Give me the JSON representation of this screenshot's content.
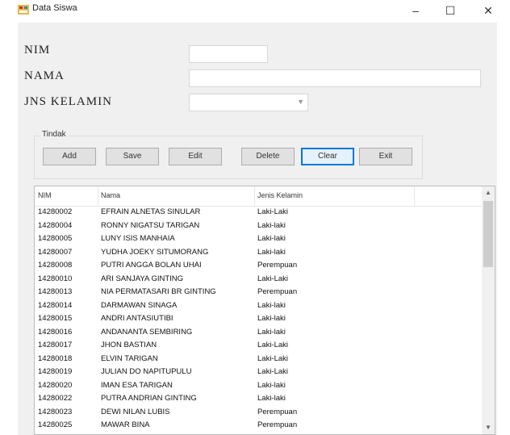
{
  "window": {
    "title": "Data Siswa",
    "min_glyph": "–",
    "max_glyph": "☐",
    "close_glyph": "✕"
  },
  "form": {
    "nim_label": "NIM",
    "nama_label": "NAMA",
    "jk_label": "JNS KELAMIN",
    "nim_value": "",
    "nama_value": "",
    "jk_value": ""
  },
  "group": {
    "legend": "Tindak",
    "buttons": [
      "Add",
      "Save",
      "Edit",
      "Delete",
      "Clear",
      "Exit"
    ]
  },
  "table": {
    "columns": [
      "NIM",
      "Nama",
      "Jenis Kelamin"
    ],
    "rows": [
      [
        "14280002",
        "EFRAIN ALNETAS SINULAR",
        "Laki-Laki"
      ],
      [
        "14280004",
        "RONNY NIGATSU TARIGAN",
        "Laki-laki"
      ],
      [
        "14280005",
        "LUNY ISIS MANHAIA",
        "Laki-laki"
      ],
      [
        "14280007",
        "YUDHA JOEKY SITUMORANG",
        "Laki-laki"
      ],
      [
        "14280008",
        "PUTRI ANGGA BOLAN UHAI",
        "Perempuan"
      ],
      [
        "14280010",
        "ARI SANJAYA GINTING",
        "Laki-Laki"
      ],
      [
        "14280013",
        "NIA PERMATASARI BR GINTING",
        "Perempuan"
      ],
      [
        "14280014",
        "DARMAWAN SINAGA",
        "Laki-laki"
      ],
      [
        "14280015",
        "ANDRI ANTASIUTIBI",
        "Laki-laki"
      ],
      [
        "14280016",
        "ANDANANTA SEMBIRING",
        "Laki-laki"
      ],
      [
        "14280017",
        "JHON BASTIAN",
        "Laki-Laki"
      ],
      [
        "14280018",
        "ELVIN TARIGAN",
        "Laki-Laki"
      ],
      [
        "14280019",
        "JULIAN DO NAPITUPULU",
        "Laki-Laki"
      ],
      [
        "14280020",
        "IMAN ESA TARIGAN",
        "Laki-laki"
      ],
      [
        "14280022",
        "PUTRA ANDRIAN GINTING",
        "Laki-laki"
      ],
      [
        "14280023",
        "DEWI NILAN LUBIS",
        "Perempuan"
      ],
      [
        "14280025",
        "MAWAR BINA",
        "Perempuan"
      ]
    ]
  }
}
